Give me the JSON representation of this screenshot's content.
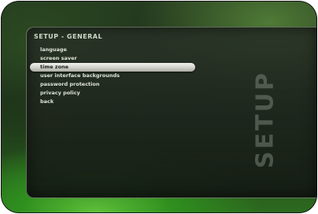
{
  "screen": {
    "section_title": "SETUP - GENERAL",
    "side_label": "SETUP"
  },
  "menu": {
    "items": [
      {
        "label": "language",
        "selected": false
      },
      {
        "label": "screen saver",
        "selected": false
      },
      {
        "label": "time zone",
        "selected": true
      },
      {
        "label": "user interface backgrounds",
        "selected": false
      },
      {
        "label": "password protection",
        "selected": false
      },
      {
        "label": "privacy policy",
        "selected": false
      },
      {
        "label": "back",
        "selected": false
      }
    ]
  },
  "colors": {
    "accent_green": "#2f8f1e",
    "panel": "#1c2419",
    "text": "#dfe4d8",
    "highlight": "#cfd0ca"
  }
}
